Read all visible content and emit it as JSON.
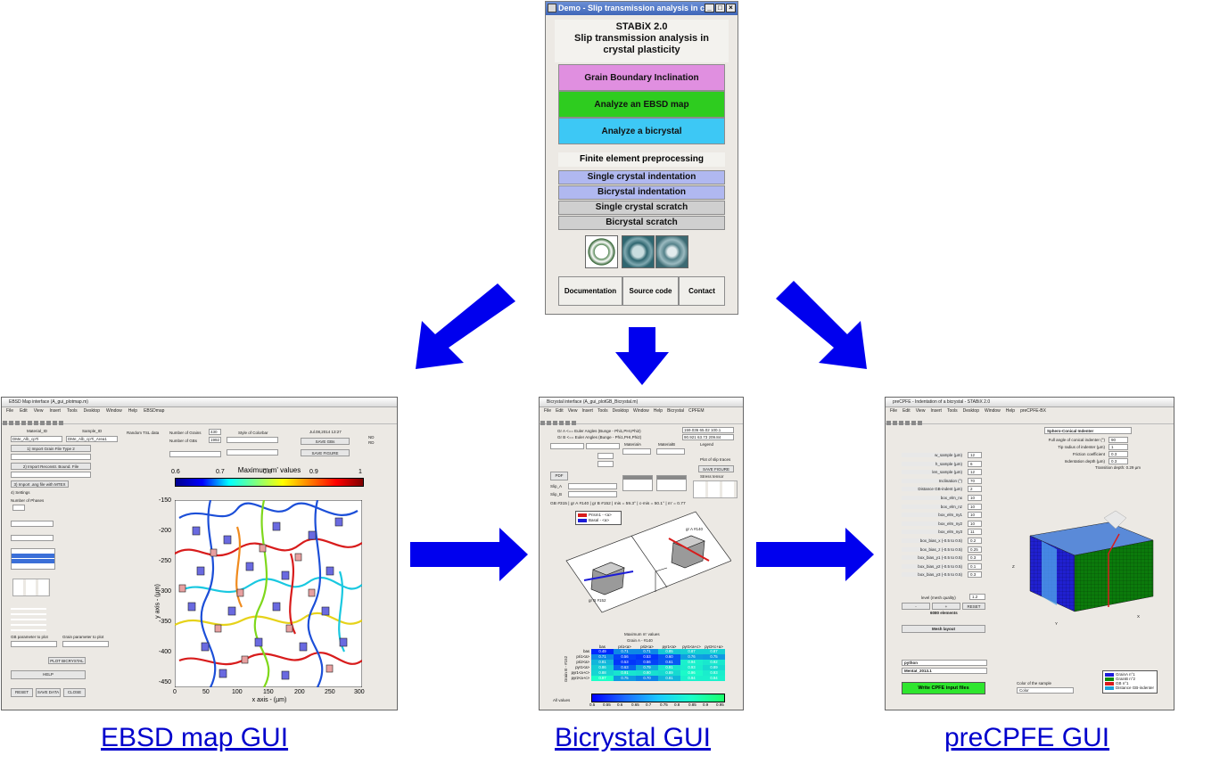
{
  "main_window": {
    "title": "Demo - Slip transmission analysis in cr...",
    "app_name": "STABiX 2.0",
    "subtitle_line1": "Slip transmission analysis in",
    "subtitle_line2": "crystal plasticity",
    "buttons": {
      "gb_inclination": "Grain Boundary Inclination",
      "ebsd_map": "Analyze an EBSD map",
      "bicrystal": "Analyze a bicrystal"
    },
    "fe_header": "Finite element preprocessing",
    "fe_buttons": {
      "single_indentation": "Single crystal indentation",
      "bicrystal_indentation": "Bicrystal indentation",
      "single_scratch": "Single crystal scratch",
      "bicrystal_scratch": "Bicrystal scratch"
    },
    "footer": {
      "documentation": "Documentation",
      "source_code": "Source code",
      "contact": "Contact"
    }
  },
  "colors": {
    "gb_inclination": "#e08fe0",
    "ebsd_map": "#2ecc1f",
    "bicrystal": "#3dc8f5",
    "fe_blue": "#b0b8f0",
    "fe_gray": "#cfcfcf",
    "arrow": "#0000ee"
  },
  "ebsd_gui": {
    "title": "EBSD Map interface (A_gui_plotmap.m)",
    "menu": [
      "File",
      "Edit",
      "View",
      "Insert",
      "Tools",
      "Desktop",
      "Window",
      "Help",
      "EBSDmap"
    ],
    "plot_title": "Maximum m' values",
    "colorbar_ticks": [
      "0.6",
      "0.7",
      "0.8",
      "0.9",
      "1"
    ],
    "y_ticks": [
      "-150",
      "-200",
      "-250",
      "-300",
      "-350",
      "-400",
      "-450"
    ],
    "x_ticks": [
      "0",
      "50",
      "100",
      "150",
      "200",
      "250",
      "300"
    ],
    "xlabel": "x axis - (µm)",
    "ylabel": "y axis - (µm)",
    "labels": {
      "material_id": "Material_ID",
      "sample_id": "Sample_ID",
      "material_val": "DMe_Alb_cpTi",
      "sample_val": "DMe_Alb_cpTi_Area1",
      "import_grain": "1) Import Grain File Type 2",
      "import_recon": "2) Import Reconstr. Bound. File",
      "import_ang": "3) Import .ang file with MTEX",
      "settings": "4) Settings",
      "num_phases": "Number of Phases",
      "random_tsl": "Random TSL data",
      "num_grains": "Number of Grains",
      "num_grains_val": "430",
      "num_gbs": "Number of GBs",
      "num_gbs_val": "1992",
      "style_colorbar": "Style of Colorbar",
      "date": "Jul.08,2014 13:27",
      "save_gbs": "SAVE GBs",
      "save_figure": "SAVE FIGURE",
      "help": "HELP",
      "reset": "RESET",
      "save_data": "SAVE DATA",
      "close": "CLOSE",
      "plot_bicrystal": "PLOT BICRYSTAL",
      "gb_param": "GB parameter to plot",
      "grain_param": "Grain parameter to plot",
      "nd_label": "ND",
      "rd_label": "RD"
    }
  },
  "bicrystal_gui": {
    "title": "Bicrystal interface (A_gui_plotGB_Bicrystal.m)",
    "menu": [
      "File",
      "Edit",
      "View",
      "Insert",
      "Tools",
      "Desktop",
      "Window",
      "Help",
      "Bicrystal",
      "CPFEM"
    ],
    "euler_a": "Gr A <== Euler Angles (Bunge - Phi1,PHI,Phi2)",
    "euler_b": "Gr B <== Euler Angles (Bunge - Phi1,PHI,Phi2)",
    "euler_a_val": "159.036 65.02 100.1",
    "euler_b_val": "90.921 63.73 209.84",
    "legend": "Legend",
    "gb_info": "GB #315 | gr A #140 | gr B #152 | mis = 59.3° | c-mis = 50.1° | m' = 0.77",
    "legend_items": [
      "Prism1 - <a>",
      "Basal - <a>"
    ],
    "grain_a_label": "gr A #140",
    "grain_b_label": "gr B #152",
    "matrix_title": "Maximum m' values",
    "matrix_subtitle": "Grain A - #140",
    "matrix_cols": [
      "bas",
      "pri1<a>",
      "pri2<a>",
      "pyr1<a>",
      "pyr1<a+c>",
      "pyr2<c+a>"
    ],
    "matrix_rows": [
      {
        "label": "bas",
        "values": [
          "0.49",
          "0.71",
          "0.71",
          "0.85",
          "0.87",
          "0.87"
        ]
      },
      {
        "label": "pri1<a>",
        "values": [
          "0.71",
          "0.56",
          "0.53",
          "0.60",
          "0.76",
          "0.75"
        ]
      },
      {
        "label": "pri2<a>",
        "values": [
          "0.81",
          "0.53",
          "0.56",
          "0.61",
          "0.94",
          "0.92"
        ]
      },
      {
        "label": "pyr1<a>",
        "values": [
          "0.86",
          "0.63",
          "0.79",
          "0.91",
          "0.93",
          "0.89"
        ]
      },
      {
        "label": "pyr1<a+c>",
        "values": [
          "0.88",
          "0.91",
          "0.90",
          "0.89",
          "0.96",
          "0.93"
        ]
      },
      {
        "label": "pyr2<a+c>",
        "values": [
          "0.97",
          "0.75",
          "0.70",
          "0.81",
          "0.94",
          "0.94"
        ]
      }
    ],
    "colorbar_ticks": [
      "0.5",
      "0.55",
      "0.6",
      "0.65",
      "0.7",
      "0.75",
      "0.8",
      "0.85",
      "0.9",
      "0.95"
    ],
    "all_values": "All values",
    "grain_b_axis": "Grain B - #152",
    "pdf_button": "PDF",
    "save_figure": "SAVE FIGURE",
    "stress_tensor": "Stress tensor",
    "plot_slip_traces": "Plot of slip traces",
    "material_a": "MaterialA",
    "material_b": "MaterialB",
    "slip_a": "Slip_A",
    "slip_b": "Slip_B"
  },
  "precpfe_gui": {
    "title": "preCPFE - Indentation of a bicrystal - STABiX 2.0",
    "menu": [
      "File",
      "Edit",
      "View",
      "Insert",
      "Tools",
      "Desktop",
      "Window",
      "Help",
      "preCPFE-BX"
    ],
    "indenter": "Sphero-Conical Indenter",
    "params_right": [
      {
        "label": "Full angle of conical indenter (°)",
        "value": "90"
      },
      {
        "label": "Tip radius of indenter (µm)",
        "value": "1"
      },
      {
        "label": "Friction coefficient",
        "value": "0.3"
      },
      {
        "label": "Indentation depth (µm)",
        "value": "0.3"
      }
    ],
    "transition": "Transition depth: 0.29 µm",
    "params_left": [
      {
        "label": "w_sample (µm)",
        "value": "12"
      },
      {
        "label": "h_sample (µm)",
        "value": "6"
      },
      {
        "label": "len_sample (µm)",
        "value": "12"
      },
      {
        "label": "Inclination (°)",
        "value": "70"
      },
      {
        "label": "Distance GB-indent (µm)",
        "value": "2"
      },
      {
        "label": "box_elm_nx",
        "value": "10"
      },
      {
        "label": "box_elm_nz",
        "value": "10"
      },
      {
        "label": "box_elm_ny1",
        "value": "10"
      },
      {
        "label": "box_elm_ny2",
        "value": "10"
      },
      {
        "label": "box_elm_ny3",
        "value": "11"
      },
      {
        "label": "box_bias_x (-0.5 to 0.5)",
        "value": "0.2"
      },
      {
        "label": "box_bias_z (-0.5 to 0.5)",
        "value": "0.25"
      },
      {
        "label": "box_bias_y1 (-0.5 to 0.5)",
        "value": "0.3"
      },
      {
        "label": "box_bias_y2 (-0.5 to 0.5)",
        "value": "0.1"
      },
      {
        "label": "box_bias_y3 (-0.5 to 0.5)",
        "value": "0.3"
      }
    ],
    "level_mesh": "level (mesh quality)",
    "level_val": "1.2",
    "elements": "6080 elements",
    "reset": "RESET",
    "mesh_layout": "Mesh layout",
    "python": "python",
    "mentat": "Mentat_2013.1",
    "write_button": "Write CPFE input files",
    "color_sample": "Color of the sample",
    "color_val": "Color",
    "legend": [
      "GrainA n°1",
      "GrainB n°2",
      "GB n°1",
      "Distance GB-indenter"
    ],
    "axis_labels": {
      "x": "X",
      "y": "Y",
      "z": "Z"
    }
  },
  "captions": {
    "ebsd": "EBSD map GUI",
    "bicrystal": "Bicrystal GUI",
    "precpfe": "preCPFE GUI"
  }
}
